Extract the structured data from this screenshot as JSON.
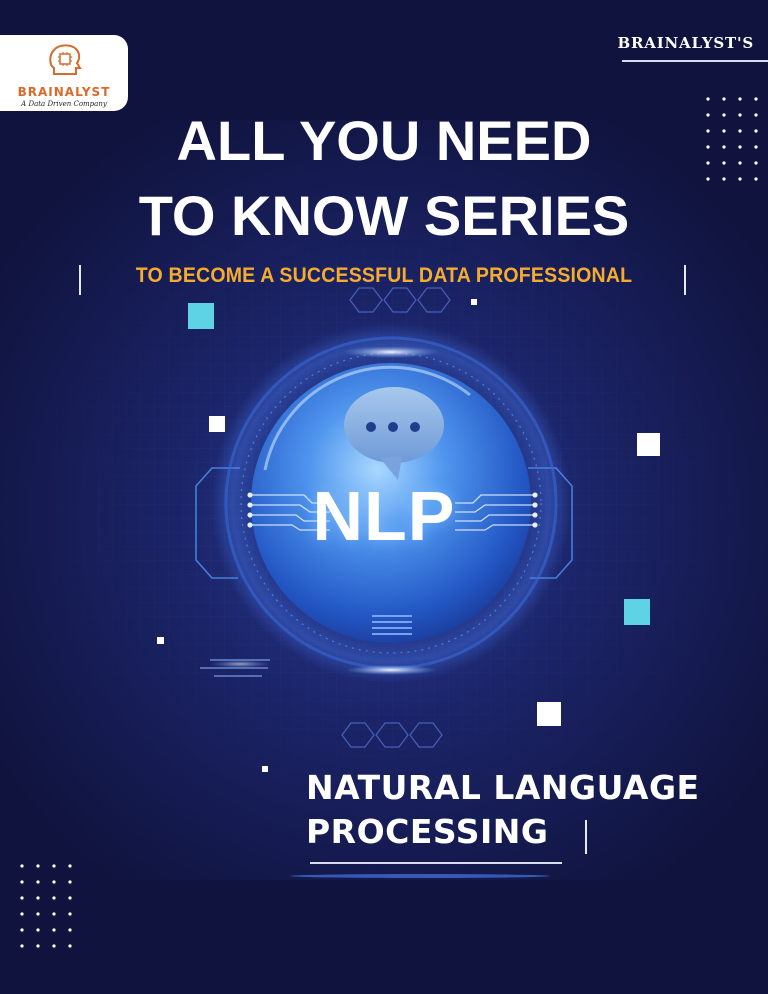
{
  "brand": {
    "name": "BRAINALYST",
    "tagline": "A Data Driven Company",
    "name_color": "#d86a2b",
    "icon": "brain-head-icon"
  },
  "series_tag": "BRAINALYST'S",
  "headline": {
    "line1": "ALL YOU NEED",
    "line2": "TO KNOW SERIES"
  },
  "subtitle": "TO BECOME A SUCCESSFUL DATA PROFESSIONAL",
  "hero": {
    "label": "NLP",
    "bubble_icon": "chat-bubble-icon"
  },
  "topic": {
    "line1": "NATURAL LANGUAGE",
    "line2": "PROCESSING"
  },
  "colors": {
    "background": "#10133d",
    "accent": "#f5ac2e",
    "globe": "#2e6fd6",
    "cyan_square": "#5fd3e6"
  }
}
